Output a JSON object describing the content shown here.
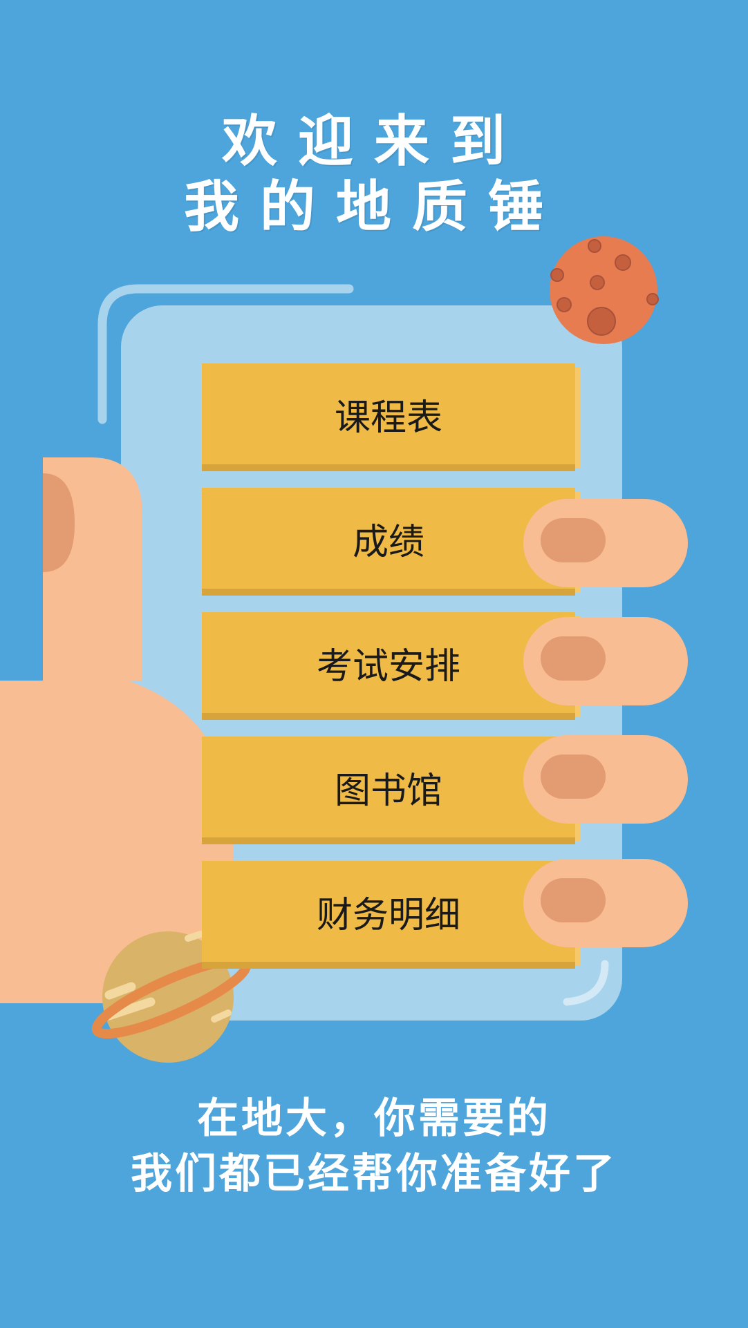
{
  "header": {
    "line1": "欢迎来到",
    "line2": "我的地质锤"
  },
  "menu": [
    {
      "label": "课程表"
    },
    {
      "label": "成绩"
    },
    {
      "label": "考试安排"
    },
    {
      "label": "图书馆"
    },
    {
      "label": "财务明细"
    }
  ],
  "footer": {
    "line1": "在地大，你需要的",
    "line2": "我们都已经帮你准备好了"
  },
  "colors": {
    "background": "#4ea5db",
    "panel": "#a8d3ed",
    "button": "#efba45",
    "skin": "#f8bd92",
    "nail": "#e39b72",
    "mars": "#e67c50",
    "saturn": "#d9b368"
  },
  "icons": [
    "planet-mars-icon",
    "planet-saturn-icon",
    "hand-thumb-icon",
    "hand-fingers-icon"
  ]
}
